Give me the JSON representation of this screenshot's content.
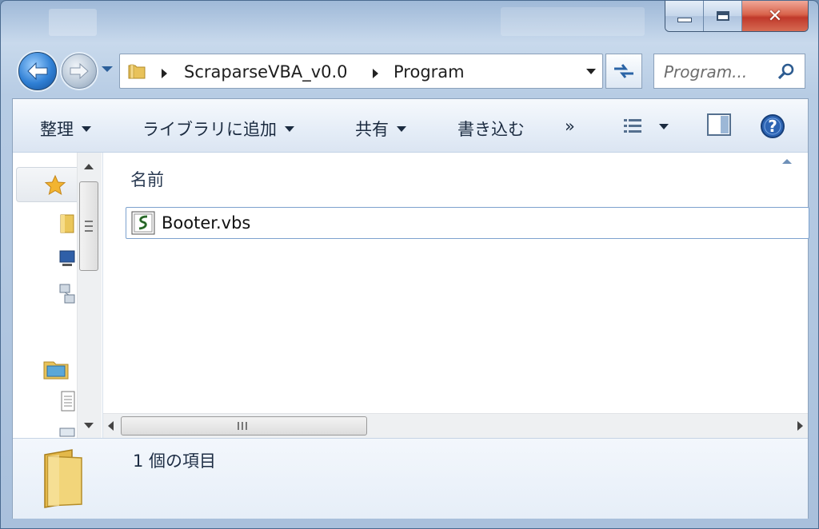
{
  "window": {
    "caption_buttons": {
      "minimize": "minimize",
      "maximize": "maximize",
      "close": "✕"
    }
  },
  "address": {
    "crumbs": [
      "ScraparseVBA_v0.0",
      "Program"
    ]
  },
  "search": {
    "placeholder": "Program..."
  },
  "toolbar": {
    "organize": "整理",
    "add_to_library": "ライブラリに追加",
    "share": "共有",
    "burn": "書き込む",
    "more": "»"
  },
  "files": {
    "column_name": "名前",
    "items": [
      {
        "name": "Booter.vbs",
        "icon": "vbscript-file-icon"
      }
    ]
  },
  "details": {
    "item_count": "1 個の項目"
  },
  "colors": {
    "accent": "#2f7fd4",
    "close": "#c0392b",
    "selection_border": "#7da2ce"
  }
}
